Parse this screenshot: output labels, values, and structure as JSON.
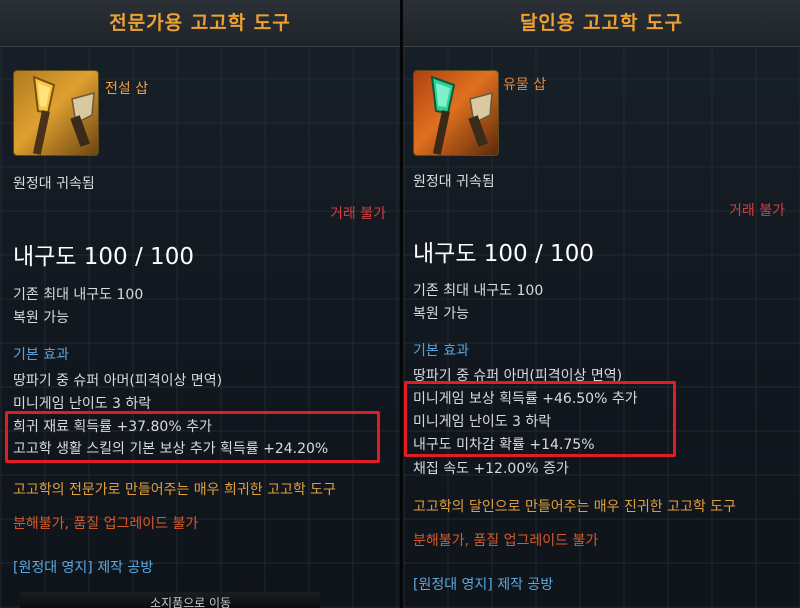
{
  "left": {
    "title": "전문가용 고고학 도구",
    "item_name": "전설 삽",
    "bind": "원정대 귀속됨",
    "tradable": "거래 불가",
    "durability": "내구도 100 / 100",
    "max_durability": "기존 최대 내구도 100",
    "repair": "복원 가능",
    "effects_label": "기본 효과",
    "effects": [
      "땅파기 중 슈퍼 아머(피격이상 면역)",
      "미니게임 난이도 3 하락",
      "희귀 재료 획득률 +37.80% 추가",
      "고고학 생활 스킬의 기본 보상 추가 획득률 +24.20%"
    ],
    "description": "고고학의 전문가로 만들어주는 매우 희귀한 고고학 도구",
    "restriction": "분해불가, 품질 업그레이드 불가",
    "workshop": "[원정대 영지] 제작 공방",
    "bottom_text": "소지품으로 이동"
  },
  "right": {
    "title": "달인용 고고학 도구",
    "item_name": "유물 삽",
    "bind": "원정대 귀속됨",
    "tradable": "거래 불가",
    "durability": "내구도 100 / 100",
    "max_durability": "기존 최대 내구도 100",
    "repair": "복원 가능",
    "effects_label": "기본 효과",
    "effects": [
      "땅파기 중 슈퍼 아머(피격이상 면역)",
      "미니게임 보상 획득률 +46.50% 추가",
      "미니게임 난이도 3 하락",
      "내구도 미차감 확률 +14.75%",
      "채집 속도 +12.00% 증가"
    ],
    "description": "고고학의 달인으로 만들어주는 매우 진귀한 고고학 도구",
    "restriction": "분해불가, 품질 업그레이드 불가",
    "workshop": "[원정대 영지] 제작 공방"
  },
  "colors": {
    "title": "#f0a030",
    "highlight": "#e01c24",
    "section": "#5aa0d8",
    "description": "#e0a040",
    "untradable": "#d04040"
  },
  "icons": {
    "left_item": "golden-shovel-icon",
    "right_item": "green-shovel-icon"
  }
}
